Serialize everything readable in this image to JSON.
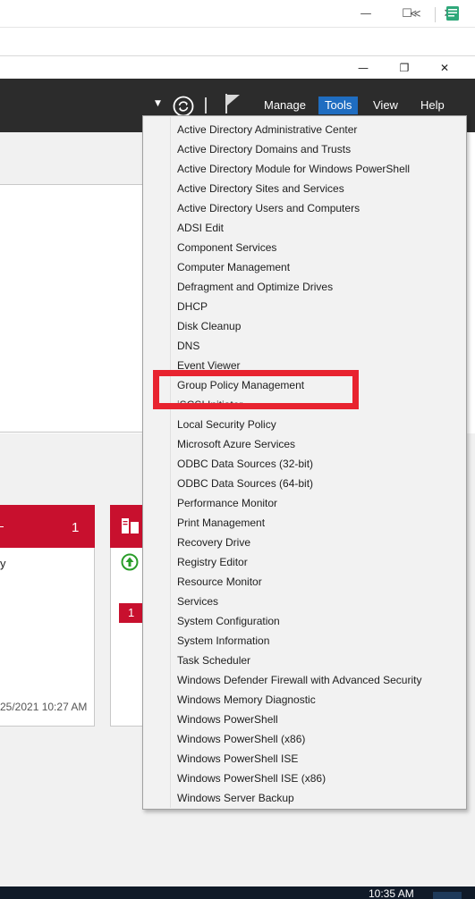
{
  "outer_window": {
    "minimize_glyph": "—",
    "maximize_glyph": "☐",
    "close_glyph": "✕",
    "collapse_glyph": "≪"
  },
  "inner_window": {
    "minimize_glyph": "—",
    "restore_glyph": "❐",
    "close_glyph": "✕"
  },
  "header": {
    "dropdown_glyph": "▼",
    "menus": [
      "Manage",
      "Tools",
      "View",
      "Help"
    ],
    "active_menu": "Tools"
  },
  "tools_menu": {
    "items": [
      "Active Directory Administrative Center",
      "Active Directory Domains and Trusts",
      "Active Directory Module for Windows PowerShell",
      "Active Directory Sites and Services",
      "Active Directory Users and Computers",
      "ADSI Edit",
      "Component Services",
      "Computer Management",
      "Defragment and Optimize Drives",
      "DHCP",
      "Disk Cleanup",
      "DNS",
      "Event Viewer",
      "Group Policy Management",
      "iSCSI Initiator",
      "Local Security Policy",
      "Microsoft Azure Services",
      "ODBC Data Sources (32-bit)",
      "ODBC Data Sources (64-bit)",
      "Performance Monitor",
      "Print Management",
      "Recovery Drive",
      "Registry Editor",
      "Resource Monitor",
      "Services",
      "System Configuration",
      "System Information",
      "Task Scheduler",
      "Windows Defender Firewall with Advanced Security",
      "Windows Memory Diagnostic",
      "Windows PowerShell",
      "Windows PowerShell (x86)",
      "Windows PowerShell ISE",
      "Windows PowerShell ISE (x86)",
      "Windows Server Backup"
    ],
    "highlighted_item": "Group Policy Management"
  },
  "tiles": {
    "tile1_count": "1",
    "tile1_partial_text": "y",
    "tile1_timestamp": "25/2021 10:27 AM",
    "tile2_badge": "1"
  },
  "taskbar": {
    "clock": "10:35 AM"
  },
  "colors": {
    "header_bg": "#2c2c2c",
    "active_menu_bg": "#1f6dc1",
    "alert_red": "#c8102e",
    "highlight_box": "#e8232f",
    "menu_bg": "#f2f2f2"
  }
}
